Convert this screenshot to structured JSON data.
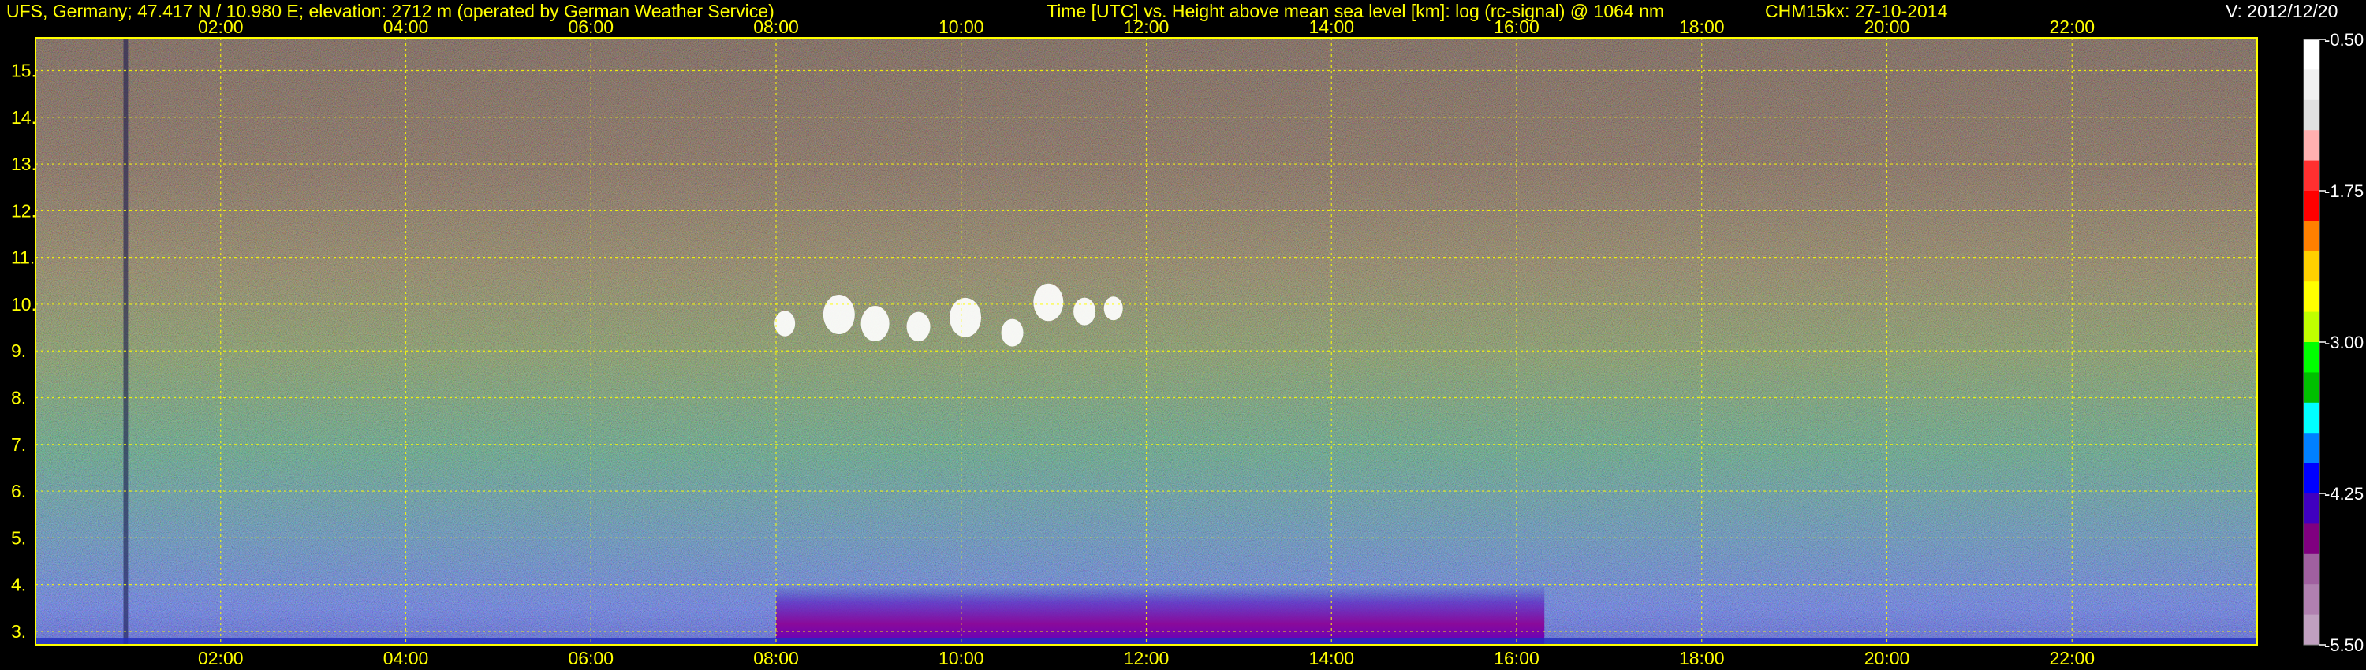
{
  "header": {
    "site": "UFS, Germany; 47.417 N / 10.980 E; elevation: 2712 m  (operated by German Weather Service)",
    "title": "Time [UTC] vs. Height above mean sea level [km]: log (rc-signal) @ 1064 nm",
    "instrument": "CHM15kx: 27-10-2014",
    "version": "V: 2012/12/20"
  },
  "colors": {
    "background": "#000000",
    "text": "#ffff00",
    "grid": "#ffff00",
    "frame": "#ffff00"
  },
  "chart_data": {
    "type": "heatmap",
    "title": "Time [UTC] vs. Height above mean sea level [km]: log (rc-signal) @ 1064 nm",
    "x_axis": {
      "label": "Time [UTC]",
      "range_hours": [
        0,
        24
      ],
      "ticks": [
        "02:00",
        "04:00",
        "06:00",
        "08:00",
        "10:00",
        "12:00",
        "14:00",
        "16:00",
        "18:00",
        "20:00",
        "22:00"
      ],
      "tick_hours": [
        2,
        4,
        6,
        8,
        10,
        12,
        14,
        16,
        18,
        20,
        22
      ]
    },
    "y_axis": {
      "label": "Height above mean sea level [km]",
      "range_km": [
        2.712,
        15.7
      ],
      "ticks": [
        "3.",
        "4.",
        "5.",
        "6.",
        "7.",
        "8.",
        "9.",
        "10.",
        "11.",
        "12.",
        "13.",
        "14.",
        "15."
      ],
      "tick_values": [
        3,
        4,
        5,
        6,
        7,
        8,
        9,
        10,
        11,
        12,
        13,
        14,
        15
      ]
    },
    "colorbar": {
      "label": "log (rc-signal)",
      "range": [
        -5.5,
        -0.5
      ],
      "ticks": [
        "-0.50",
        "-1.75",
        "-3.00",
        "-4.25",
        "-5.50"
      ],
      "tick_values": [
        -0.5,
        -1.75,
        -3.0,
        -4.25,
        -5.5
      ],
      "colors_top_to_bottom": [
        "#ffffff",
        "#f0f0f0",
        "#e0e0e0",
        "#ffb0b0",
        "#ff3030",
        "#ff0000",
        "#ff8000",
        "#ffd000",
        "#ffff00",
        "#c0ff00",
        "#00ff00",
        "#00c000",
        "#00ffff",
        "#0080ff",
        "#0000ff",
        "#4000c0",
        "#800080",
        "#a060a0",
        "#b080b0",
        "#c0a0c0"
      ]
    },
    "features": [
      {
        "name": "cirrus cloud",
        "time_start": 7.9,
        "time_end": 11.8,
        "height_km_low": 9.0,
        "height_km_high": 10.3
      },
      {
        "name": "enhanced boundary layer signal",
        "time_start": 8.0,
        "time_end": 16.3,
        "height_km_low": 2.712,
        "height_km_high": 4.0
      },
      {
        "name": "instrument gap",
        "time_start": 0.95,
        "time_end": 1.0,
        "height_km_low": 2.712,
        "height_km_high": 15.7
      }
    ]
  }
}
